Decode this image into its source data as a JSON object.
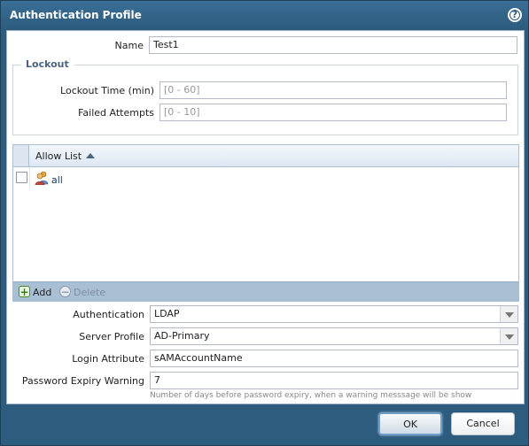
{
  "dialog": {
    "title": "Authentication Profile",
    "help_icon": "?"
  },
  "form": {
    "name_label": "Name",
    "name_value": "Test1",
    "lockout": {
      "legend": "Lockout",
      "lockout_time_label": "Lockout Time (min)",
      "lockout_time_placeholder": "[0 - 60]",
      "failed_attempts_label": "Failed Attempts",
      "failed_attempts_placeholder": "[0 - 10]"
    },
    "allow_list": {
      "column_header": "Allow List",
      "sort": "ascending",
      "rows": [
        {
          "label": "all",
          "icon": "users-icon",
          "checked": false
        }
      ],
      "add_label": "Add",
      "delete_label": "Delete"
    },
    "authentication_label": "Authentication",
    "authentication_value": "LDAP",
    "server_profile_label": "Server Profile",
    "server_profile_value": "AD-Primary",
    "login_attribute_label": "Login Attribute",
    "login_attribute_value": "sAMAccountName",
    "password_expiry_label": "Password Expiry Warning",
    "password_expiry_value": "7",
    "password_expiry_hint": "Number of days before password expiry, when a warning messsage will be show"
  },
  "buttons": {
    "ok": "OK",
    "cancel": "Cancel"
  },
  "colors": {
    "title_bar": "#2e5c7f",
    "grid_header": "#dde8f3",
    "toolbar": "#a9bfd3",
    "ok_border": "#6f9ec9"
  }
}
